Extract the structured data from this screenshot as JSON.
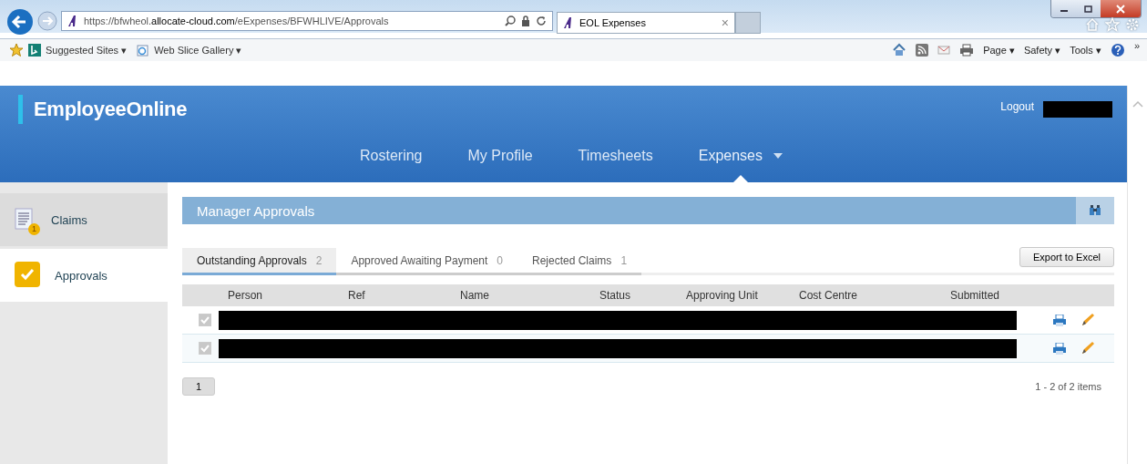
{
  "browser": {
    "url": {
      "scheme": "https://",
      "host_prefix": "bfwheol.",
      "host": "allocate-cloud.com",
      "path": "/eExpenses/BFWHLIVE/Approvals"
    },
    "tab": {
      "title": "EOL Expenses",
      "close": "×"
    },
    "favorites": [
      {
        "label": "Suggested Sites ▾"
      },
      {
        "label": "Web Slice Gallery ▾"
      }
    ],
    "command_bar": [
      "Page ▾",
      "Safety ▾",
      "Tools ▾"
    ],
    "chevron": "»"
  },
  "app": {
    "logo": "EmployeeOnline",
    "logout": "Logout",
    "nav": [
      {
        "label": "Rostering",
        "selected": false
      },
      {
        "label": "My Profile",
        "selected": false
      },
      {
        "label": "Timesheets",
        "selected": false
      },
      {
        "label": "Expenses",
        "selected": true
      }
    ],
    "sidebar": [
      {
        "label": "Claims",
        "kind": "claims",
        "badge": "1",
        "selected": false
      },
      {
        "label": "Approvals",
        "kind": "approvals",
        "selected": true
      }
    ],
    "panel_title": "Manager Approvals",
    "tabs": [
      {
        "label": "Outstanding Approvals",
        "count": "2",
        "selected": true
      },
      {
        "label": "Approved Awaiting Payment",
        "count": "0",
        "selected": false
      },
      {
        "label": "Rejected Claims",
        "count": "1",
        "selected": false
      }
    ],
    "export_button": "Export to Excel",
    "columns": [
      "Person",
      "Ref",
      "Name",
      "Status",
      "Approving Unit",
      "Cost Centre",
      "Submitted"
    ],
    "rows": [
      {
        "checked": true
      },
      {
        "checked": true
      }
    ],
    "page": "1",
    "summary": "1 - 2 of 2 items"
  }
}
